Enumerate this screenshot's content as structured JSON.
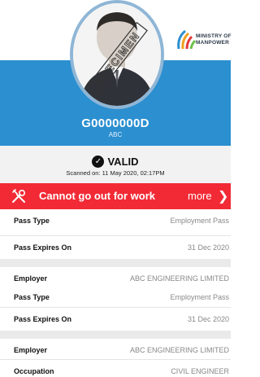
{
  "header": {
    "ministry_line1": "MINISTRY OF",
    "ministry_line2": "MANPOWER",
    "photo_watermark": "SPECIMEN"
  },
  "pass": {
    "id": "G0000000D",
    "name": "ABC",
    "status": "VALID",
    "scanned": "Scanned on: 11 May 2020, 02:17PM"
  },
  "alert": {
    "text": "Cannot go out for work",
    "more": "more",
    "color": "#f22a35"
  },
  "details": [
    {
      "label": "Pass Type",
      "value": "Employment Pass"
    },
    {
      "label": "Pass Expires On",
      "value": "31 Dec 2020"
    },
    {
      "label": "Employer",
      "value": "ABC ENGINEERING LIMITED"
    },
    {
      "label": "Pass Type",
      "value": "Employment Pass"
    },
    {
      "label": "Pass Expires On",
      "value": "31 Dec 2020"
    },
    {
      "label": "Employer",
      "value": "ABC ENGINEERING LIMITED"
    },
    {
      "label": "Occupation",
      "value": "CIVIL ENGINEER"
    }
  ],
  "colors": {
    "header_blue": "#2b8fd0",
    "alert_red": "#f22a35"
  }
}
